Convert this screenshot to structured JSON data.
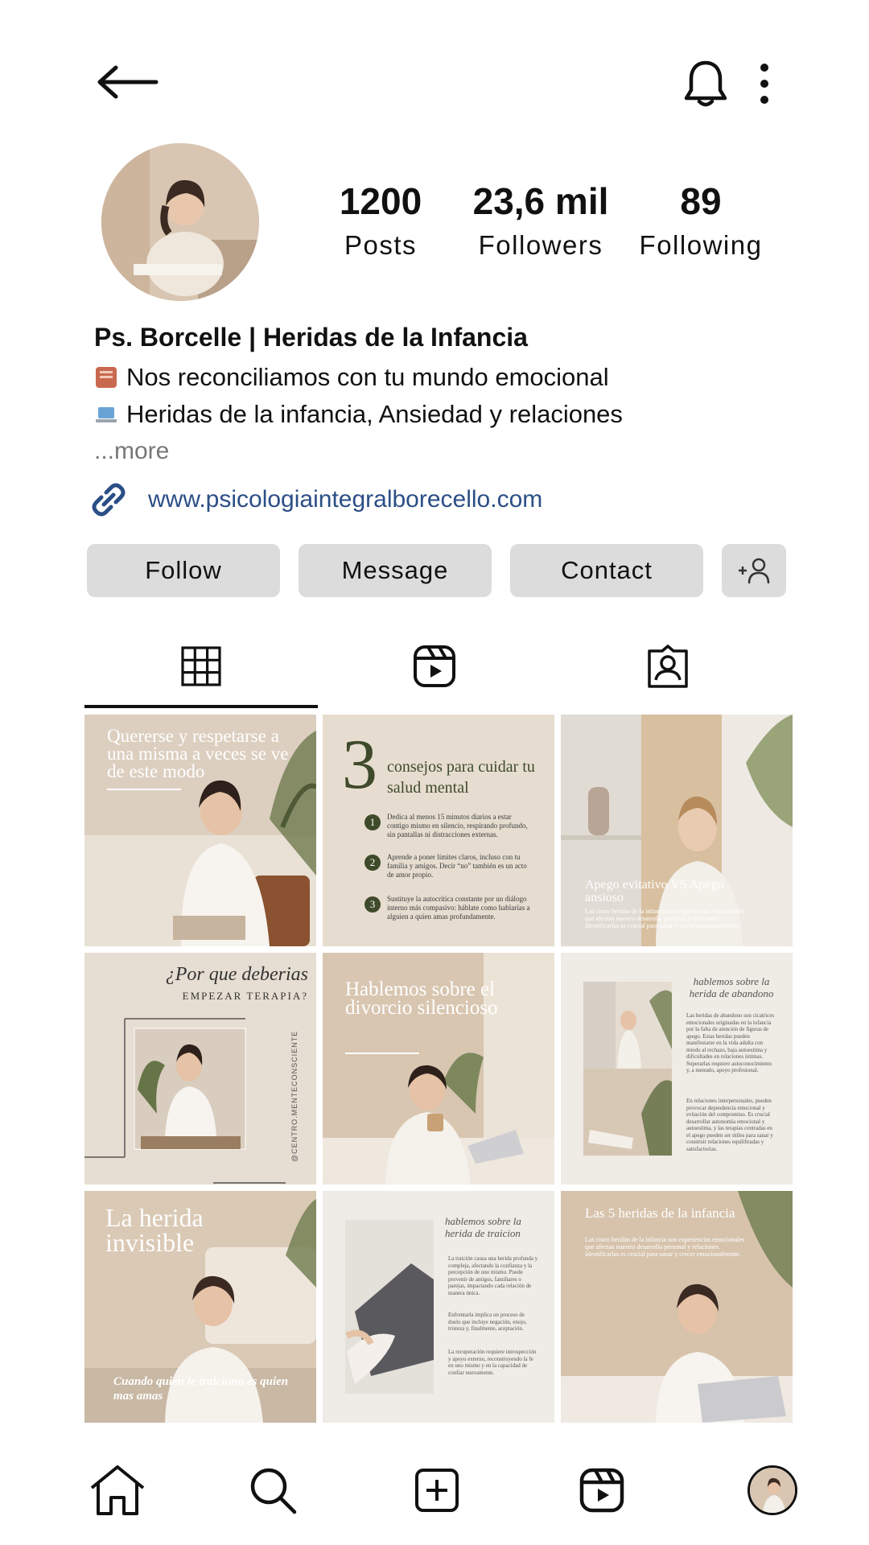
{
  "topbar": {
    "back_icon": "arrow-left-icon",
    "notifications_icon": "bell-icon",
    "options_icon": "vertical-dots-icon"
  },
  "profile": {
    "stats": [
      {
        "value": "1200",
        "label": "Posts"
      },
      {
        "value": "23,6 mil",
        "label": "Followers"
      },
      {
        "value": "89",
        "label": "Following"
      }
    ],
    "name": "Ps. Borcelle  | Heridas de la Infancia",
    "bio_lines": [
      {
        "icon": "book-icon",
        "text": "Nos reconciliamos con tu mundo emocional"
      },
      {
        "icon": "laptop-icon",
        "text": "Heridas de la infancia, Ansiedad y relaciones"
      }
    ],
    "more_label": "...more",
    "link": "www.psicologiaintegralborecello.com"
  },
  "actions": {
    "follow": "Follow",
    "message": "Message",
    "contact": "Contact",
    "add_user_icon": "add-person-icon"
  },
  "tabs": [
    {
      "icon": "grid-icon",
      "active": true
    },
    {
      "icon": "reels-icon",
      "active": false
    },
    {
      "icon": "tagged-icon",
      "active": false
    }
  ],
  "posts": {
    "p1": {
      "title": "Quererse y respetarse a una misma a veces se ve de este modo"
    },
    "p2": {
      "number": "3",
      "title": "consejos para cuidar tu salud mental",
      "tips": [
        "Dedica al menos 15 minutos diarios a estar contigo mismo en silencio, respirando profundo, sin pantallas ni distracciones externas.",
        "Aprende a poner límites claros, incluso con tu familia y amigos. Decir “no” también es un acto de amor propio.",
        "Sustituye la autocrítica constante por un diálogo interno más compasivo: háblate como hablarías a alguien a quien amas profundamente."
      ]
    },
    "p3": {
      "title": "Apego evitativo VS Apego ansioso",
      "caption": "Las cinco heridas de la infancia son experiencias emocionales que afectan nuestro desarrollo personal y relaciones. Identificarlas es crucial para sanar y crecer emocionalmente."
    },
    "p4": {
      "script": "¿Por que deberias",
      "title": "EMPEZAR TERAPIA?",
      "handle": "@CENTRO.MENTECONSCIENTE"
    },
    "p5": {
      "title": "Hablemos sobre el divorcio silencioso"
    },
    "p6": {
      "script": "hablemos sobre la herida de abandono",
      "para1": "Las heridas de abandono son cicatrices emocionales originadas en la infancia por la falta de atención de figuras de apego. Estas heridas pueden manifestarse en la vida adulta con miedo al rechazo, baja autoestima y dificultades en relaciones íntimas. Superarlas requiere autoconocimiento y, a menudo, apoyo profesional.",
      "para2": "En relaciones interpersonales, pueden provocar dependencia emocional y evitación del compromiso. Es crucial desarrollar autonomía emocional y autoestima, y las terapias centradas en el apego pueden ser útiles para sanar y construir relaciones equilibradas y satisfactorias."
    },
    "p7": {
      "title": "La herida invisible",
      "quote": "Cuando quien te traiciona es quien mas amas"
    },
    "p8": {
      "script": "hablemos sobre la herida de traicion",
      "para1": "La traición causa una herida profunda y compleja, afectando la confianza y la percepción de uno mismo. Puede provenir de amigos, familiares o parejas, impactando cada relación de manera única.",
      "para2": "Enfrentarla implica un proceso de duelo que incluye negación, enojo, tristeza y, finalmente, aceptación.",
      "para3": "La recuperación requiere introspección y apoyo externo, reconstruyendo la fe en uno mismo y en la capacidad de confiar nuevamente."
    },
    "p9": {
      "title": "Las 5 heridas de la infancia",
      "caption": "Las cinco heridas de la infancia son experiencias emocionales que afectan nuestro desarrollo personal y relaciones. Identificarlas es crucial para sanar y crecer emocionalmente."
    }
  },
  "bottom_nav": [
    {
      "icon": "home-icon"
    },
    {
      "icon": "search-icon"
    },
    {
      "icon": "create-icon"
    },
    {
      "icon": "reels-icon"
    },
    {
      "icon": "profile-avatar"
    }
  ]
}
